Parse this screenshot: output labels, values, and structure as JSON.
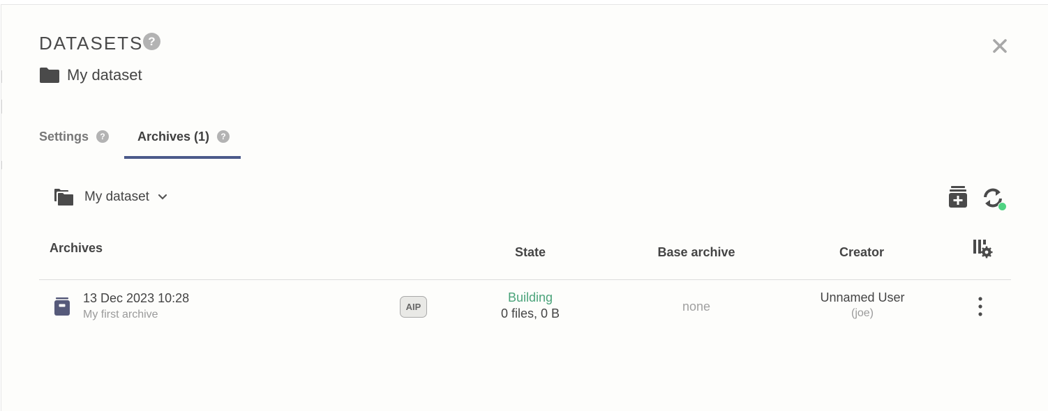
{
  "header": {
    "title": "DATASETS",
    "help_symbol": "?",
    "dataset_name": "My dataset"
  },
  "tabs": [
    {
      "label": "Settings",
      "help_symbol": "?"
    },
    {
      "label": "Archives (1)",
      "help_symbol": "?"
    }
  ],
  "toolbar": {
    "selected_dataset": "My dataset"
  },
  "table": {
    "columns": [
      "Archives",
      "State",
      "Base archive",
      "Creator"
    ],
    "rows": [
      {
        "date": "13 Dec 2023 10:28",
        "description": "My first archive",
        "badge": "AIP",
        "state": "Building",
        "state_detail": "0 files, 0 B",
        "base_archive": "none",
        "creator_name": "Unnamed User",
        "creator_login": "(joe)"
      }
    ]
  },
  "colors": {
    "accent": "#4b5a8a",
    "state_building": "#4aa37a",
    "sync_dot": "#4fd382"
  }
}
